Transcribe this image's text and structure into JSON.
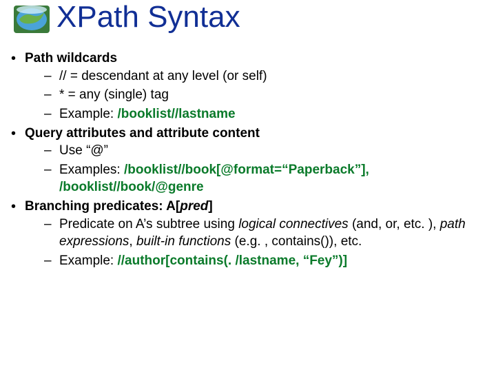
{
  "title": "XPath Syntax",
  "bullets": {
    "b1": {
      "head": "Path wildcards",
      "s1_a": " // = descendant at any level  (or self)",
      "s2_a": "*   = any (single) tag",
      "s3_a": "Example:  ",
      "s3_code": "/booklist//lastname"
    },
    "b2": {
      "head": "Query attributes and attribute content",
      "s1": "Use “@”",
      "s2_a": "Examples:  ",
      "s2_code": "/booklist//book[@format=“Paperback”], /booklist//book/@genre"
    },
    "b3": {
      "head_a": "Branching predicates:  A[",
      "head_pred": "pred",
      "head_b": "]",
      "s1_a": "Predicate on A’s subtree using ",
      "s1_i1": "logical connectives ",
      "s1_b": "(and, or, etc. ),   ",
      "s1_i2": "path expressions",
      "s1_c": ",    ",
      "s1_i3": "built-in functions ",
      "s1_d": " (e.g. , contains()),   etc.",
      "s2_a": "Example:  ",
      "s2_code": "//author[contains(. /lastname, “Fey”)]"
    }
  }
}
